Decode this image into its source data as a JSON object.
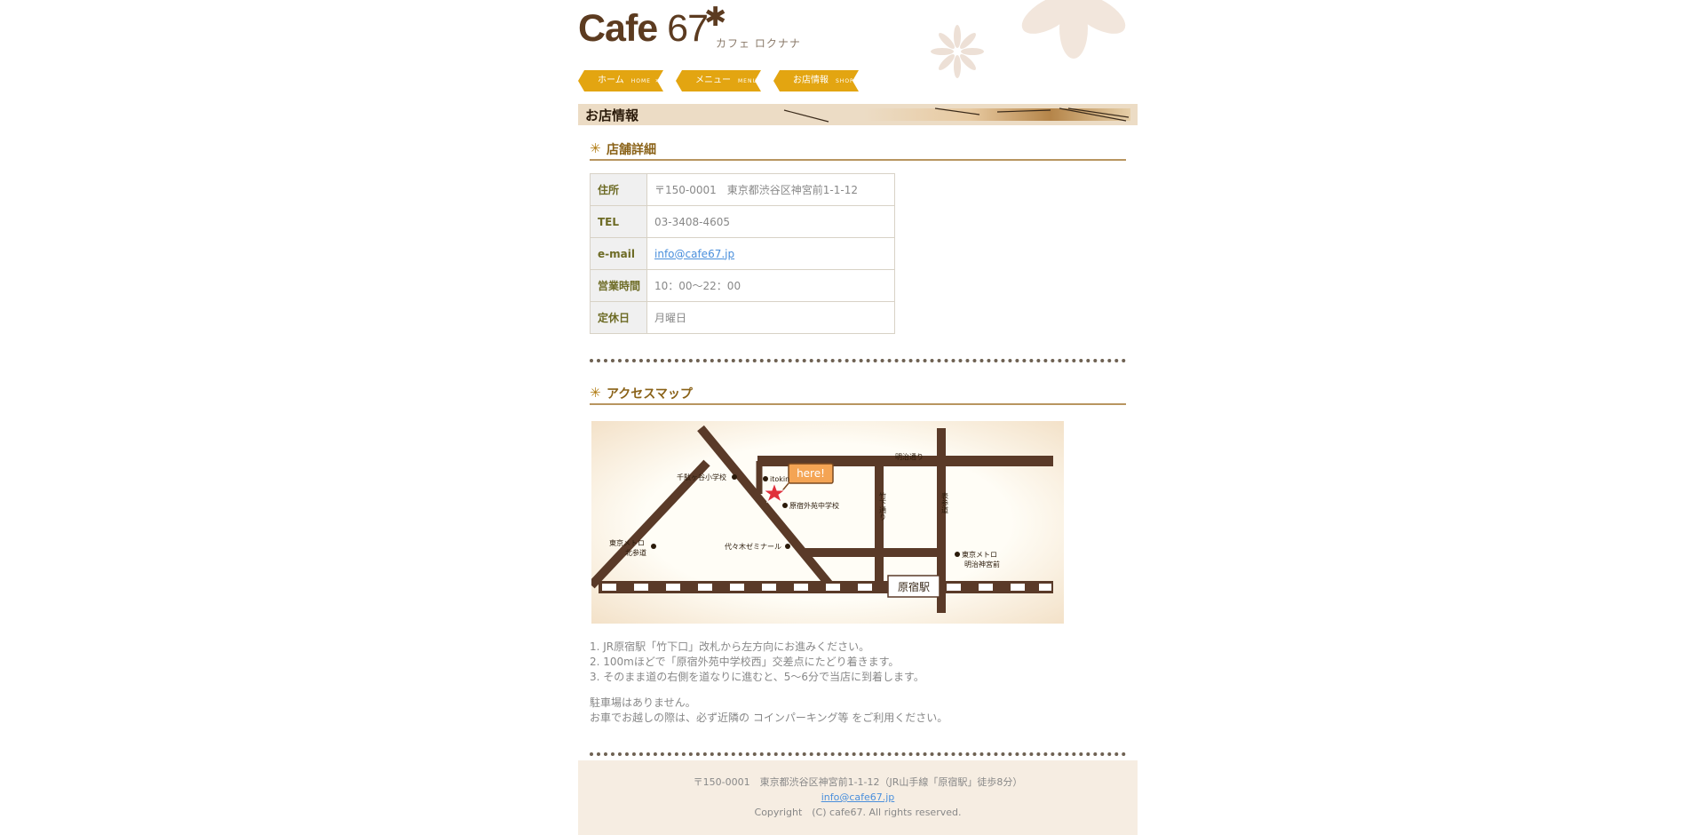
{
  "header": {
    "logo_text": "Cafe ",
    "logo_number": "67",
    "logo_star": "✱",
    "logo_subtitle": "カフェ ロクナナ"
  },
  "nav": [
    {
      "label": "ホーム",
      "en": "HOME",
      "arrow": "»"
    },
    {
      "label": "メニュー",
      "en": "MENU",
      "arrow": "»"
    },
    {
      "label": "お店情報",
      "en": "SHOP",
      "arrow": "»"
    }
  ],
  "page_title": "お店情報",
  "shop_details": {
    "heading_symbol": "✳",
    "heading": "店舗詳細",
    "rows": [
      {
        "label": "住所",
        "value": "〒150-0001　東京都渋谷区神宮前1-1-12"
      },
      {
        "label": "TEL",
        "value": "03-3408-4605"
      },
      {
        "label": "e-mail",
        "value": "info@cafe67.jp"
      },
      {
        "label": "営業時間",
        "value": "10：00〜22：00"
      },
      {
        "label": "定休日",
        "value": "月曜日"
      }
    ]
  },
  "access": {
    "heading_symbol": "✳",
    "heading": "アクセスマップ",
    "map": {
      "here": "here!",
      "itokin": "itokin",
      "sendagaya_school": "千駄ヶ谷小学校",
      "harajuku_gaien": "原宿外苑中学校",
      "meiji_dori": "明治通り",
      "takeshita_dori": "竹下通り",
      "omotesando": "表参道",
      "metro_kitasando": "東京メトロ",
      "metro_kitasando_2": "北参道",
      "yoyogi_seminar": "代々木ゼミナール",
      "metro_meiji": "東京メトロ",
      "metro_meiji_2": "明治神宮前",
      "station": "原宿駅"
    },
    "steps": [
      "1. JR原宿駅「竹下口」改札から左方向にお進みください。",
      "2. 100mほどで「原宿外苑中学校西」交差点にたどり着きます。",
      "3. そのまま道の右側を道なりに進むと、5〜6分で当店に到着します。"
    ],
    "note_1": "駐車場はありません。",
    "note_2": "お車でお越しの際は、必ず近隣の コインパーキング等 をご利用ください。"
  },
  "footer": {
    "address": "〒150-0001　東京都渋谷区神宮前1-1-12（JR山手線「原宿駅」徒歩8分）",
    "email": "info@cafe67.jp",
    "copyright": "Copyright　(C) cafe67. All rights reserved."
  },
  "colors": {
    "nav_bg": "#e3a511",
    "brown": "#5c3b20",
    "road": "#5a3a28",
    "link": "#4a8fdc"
  }
}
